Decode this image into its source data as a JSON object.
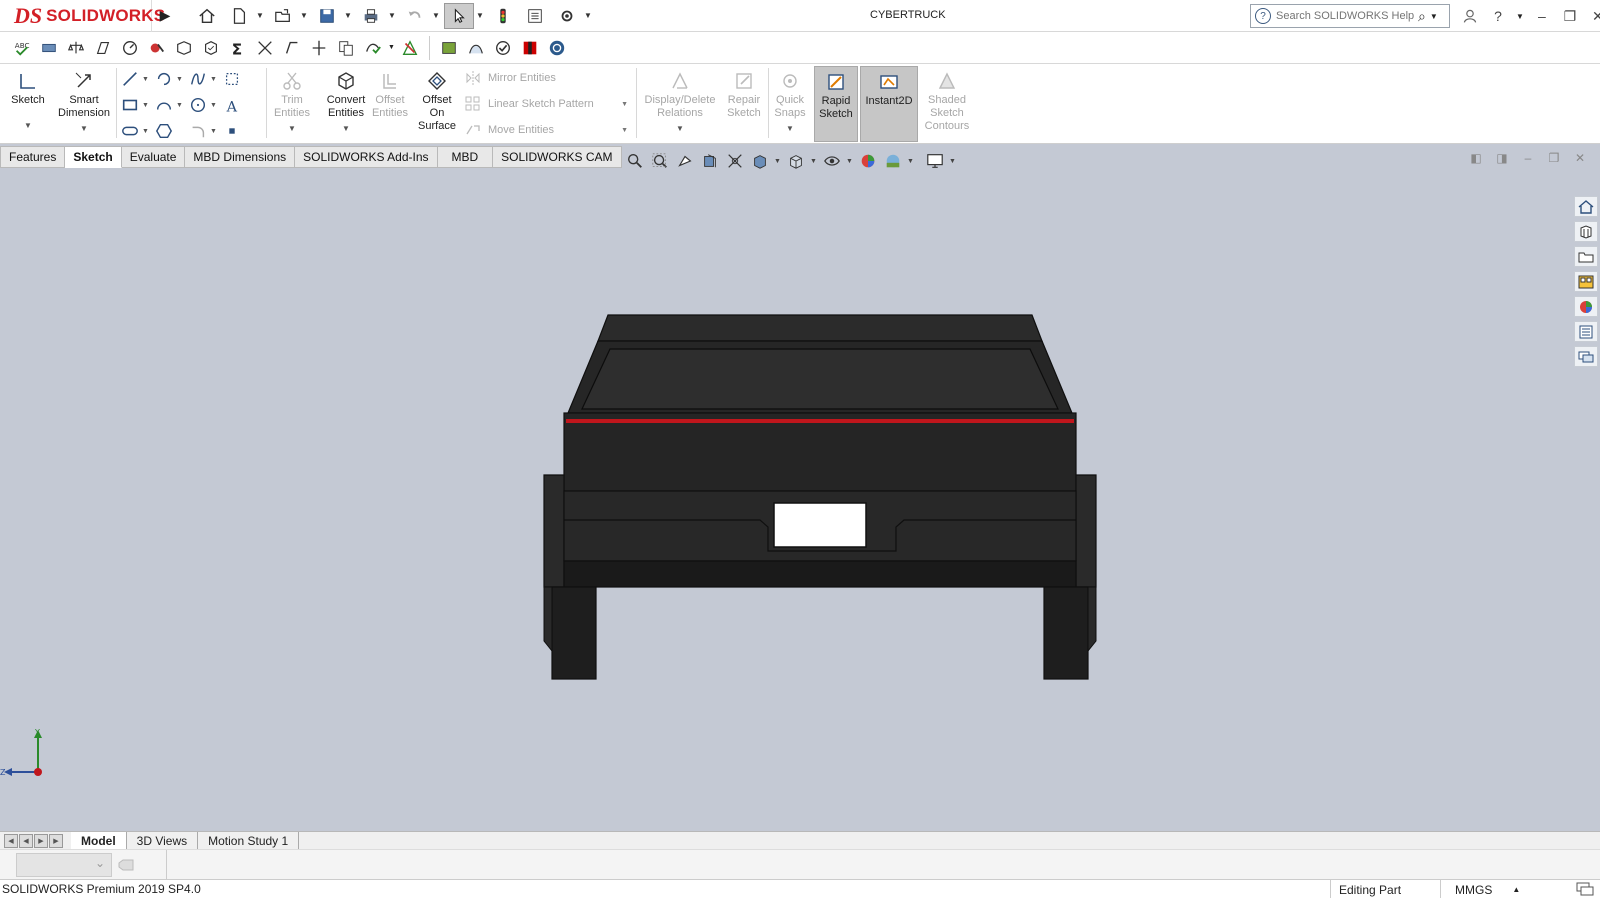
{
  "app": {
    "brand_ds": "DS",
    "brand_name": "SOLIDWORKS",
    "document_title": "CYBERTRUCK"
  },
  "search": {
    "placeholder": "Search SOLIDWORKS Help"
  },
  "ribbon": {
    "sketch": "Sketch",
    "smart_dimension": [
      "Smart",
      "Dimension"
    ],
    "trim_entities": [
      "Trim",
      "Entities"
    ],
    "convert_entities": [
      "Convert",
      "Entities"
    ],
    "offset_entities": [
      "Offset",
      "Entities"
    ],
    "offset_on_surface": [
      "Offset",
      "On",
      "Surface"
    ],
    "mirror_entities": "Mirror Entities",
    "linear_sketch_pattern": "Linear Sketch Pattern",
    "move_entities": "Move Entities",
    "display_delete_relations": [
      "Display/Delete",
      "Relations"
    ],
    "repair_sketch": [
      "Repair",
      "Sketch"
    ],
    "quick_snaps": [
      "Quick",
      "Snaps"
    ],
    "rapid_sketch": [
      "Rapid",
      "Sketch"
    ],
    "instant2d": "Instant2D",
    "shaded_sketch_contours": [
      "Shaded",
      "Sketch",
      "Contours"
    ]
  },
  "tabs": [
    {
      "label": "Features",
      "active": false
    },
    {
      "label": "Sketch",
      "active": true
    },
    {
      "label": "Evaluate",
      "active": false
    },
    {
      "label": "MBD Dimensions",
      "active": false
    },
    {
      "label": "SOLIDWORKS Add-Ins",
      "active": false
    },
    {
      "label": "MBD",
      "active": false
    },
    {
      "label": "SOLIDWORKS CAM",
      "active": false
    }
  ],
  "bottom_tabs": [
    {
      "label": "Model",
      "active": true
    },
    {
      "label": "3D Views",
      "active": false
    },
    {
      "label": "Motion Study 1",
      "active": false
    }
  ],
  "triad": {
    "y_label": "Y",
    "z_label": "Z"
  },
  "status": {
    "product": "SOLIDWORKS Premium 2019 SP4.0",
    "mode": "Editing Part",
    "units": "MMGS"
  },
  "colors": {
    "brand_red": "#d32027",
    "viewport_bg": "#c4c9d4",
    "model_body": "#2a2a2a",
    "tail_light": "#c0161c",
    "plate": "#ffffff"
  }
}
